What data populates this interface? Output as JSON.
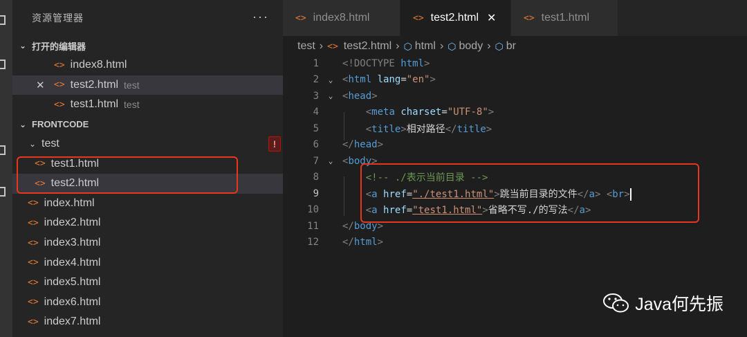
{
  "sidebar": {
    "title": "资源管理器",
    "more": "···",
    "open_editors": {
      "label": "打开的编辑器",
      "items": [
        {
          "name": "index8.html",
          "hint": ""
        },
        {
          "name": "test2.html",
          "hint": "test"
        },
        {
          "name": "test1.html",
          "hint": "test"
        }
      ]
    },
    "workspace": {
      "label": "FRONTCODE",
      "folder": "test",
      "warning": "!",
      "folder_files": [
        "test1.html",
        "test2.html"
      ],
      "files": [
        "index.html",
        "index2.html",
        "index3.html",
        "index4.html",
        "index5.html",
        "index6.html",
        "index7.html"
      ]
    }
  },
  "tabs": [
    {
      "label": "index8.html"
    },
    {
      "label": "test2.html"
    },
    {
      "label": "test1.html"
    }
  ],
  "breadcrumb": [
    "test",
    "test2.html",
    "html",
    "body",
    "br"
  ],
  "code_lines": {
    "1": {
      "open": "<!DOCTYPE ",
      "kw": "html",
      "close": ">"
    },
    "2": {
      "tag": "html",
      "attr": "lang",
      "val": "\"en\""
    },
    "3": {
      "tag": "head"
    },
    "4": {
      "tag": "meta",
      "attr": "charset",
      "val": "\"UTF-8\""
    },
    "5": {
      "tag": "title",
      "text": "相对路径"
    },
    "6": {
      "tag": "head"
    },
    "7": {
      "tag": "body"
    },
    "8": {
      "comment": "<!-- ./表示当前目录 -->"
    },
    "9": {
      "tag": "a",
      "attr": "href",
      "val": "\"./test1.html\"",
      "text": "跳当前目录的文件",
      "br": "br"
    },
    "10": {
      "tag": "a",
      "attr": "href",
      "val": "\"test1.html\"",
      "text": "省略不写./的写法"
    },
    "11": {
      "tag": "body"
    },
    "12": {
      "tag": "html"
    }
  },
  "line_numbers": [
    "1",
    "2",
    "3",
    "4",
    "5",
    "6",
    "7",
    "8",
    "9",
    "10",
    "11",
    "12"
  ],
  "watermark": "Java何先振",
  "colors": {
    "accent_file_icon": "#e37933",
    "highlight_box": "#e8371c",
    "tag": "#569cd6",
    "attribute": "#9cdcfe",
    "string": "#ce9178",
    "comment": "#6a9955"
  }
}
